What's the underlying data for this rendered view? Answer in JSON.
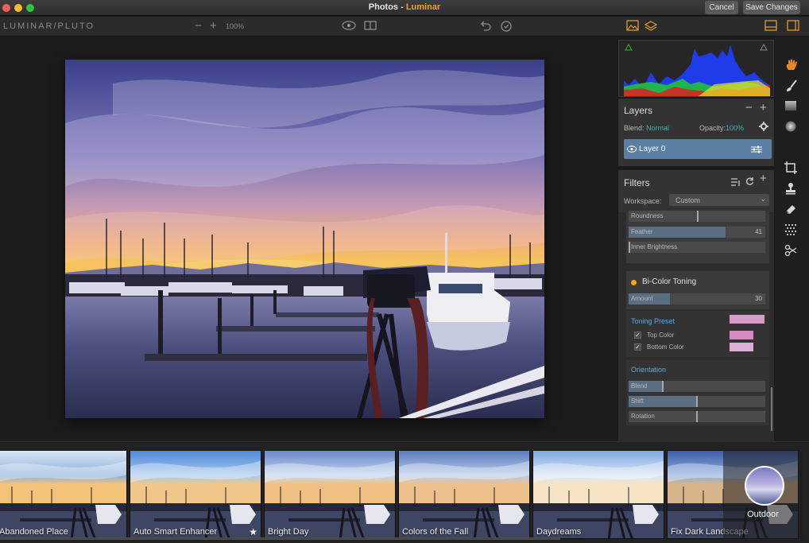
{
  "window": {
    "title": "Photos",
    "separator": " - ",
    "app": "Luminar",
    "cancel_label": "Cancel",
    "save_label": "Save Changes"
  },
  "toolbar": {
    "logo": "LUMINAR/PLUTO",
    "zoom_minus": "−",
    "zoom_plus": "+",
    "zoom": "100%"
  },
  "layers": {
    "title": "Layers",
    "minus": "−",
    "plus": "+",
    "blend_label": "Blend:",
    "blend_value": "Normal",
    "opacity_label": "Opacity:",
    "opacity_value": "100%",
    "layer_name": "Layer 0"
  },
  "filters": {
    "title": "Filters",
    "workspace_label": "Workspace:",
    "workspace_value": "Custom",
    "sliders_top": [
      {
        "label": "Roundness",
        "value": "",
        "fill": 0
      },
      {
        "label": "Feather",
        "value": "41",
        "fill": 0.71
      },
      {
        "label": "Inner Brightness",
        "value": "",
        "fill": 0
      }
    ],
    "bicolor": {
      "name": "Bi-Color Toning",
      "amount_label": "Amount",
      "amount_value": "30",
      "amount_fill": 0.3,
      "preset_title": "Toning Preset",
      "top_color_label": "Top Color",
      "bottom_color_label": "Bottom Color",
      "preset_color": "#d89ac6",
      "top_color": "#d48bc2",
      "bottom_color": "#dcaed6",
      "orientation_title": "Orientation",
      "blend_label": "Blend",
      "blend_fill": 0.25,
      "shift_label": "Shift",
      "shift_fill": 0.5,
      "rotation_label": "Rotation",
      "rotation_fill": 0.5
    }
  },
  "presets": [
    {
      "label": "Abandoned Place"
    },
    {
      "label": "Auto Smart Enhancer",
      "star": "★"
    },
    {
      "label": "Bright Day"
    },
    {
      "label": "Colors of the Fall"
    },
    {
      "label": "Daydreams"
    },
    {
      "label": "Fix Dark Landscape"
    }
  ],
  "category": {
    "label": "Outdoor"
  },
  "colors": {
    "accent": "#f3a21c",
    "teal": "#37b7c7",
    "layer_selected": "#5a7fa3"
  }
}
